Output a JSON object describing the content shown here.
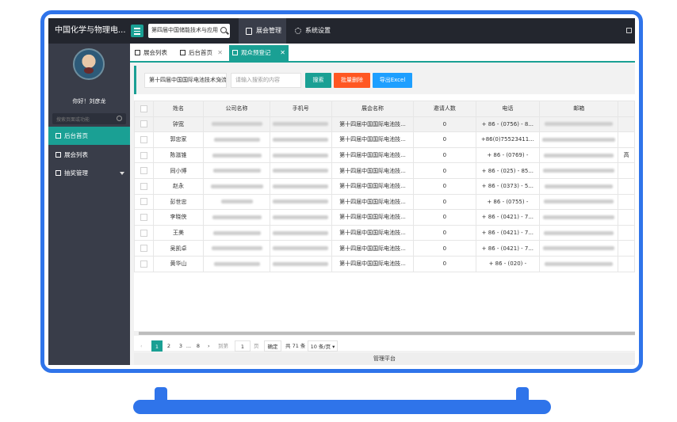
{
  "app": {
    "title": "中国化学与物理电...",
    "search_value": "第四届中国储能技术与应用展览会",
    "menus": [
      {
        "label": "展会管理",
        "icon": "calendar-icon",
        "active": true
      },
      {
        "label": "系统设置",
        "icon": "gear-icon",
        "active": false
      }
    ]
  },
  "sidebar": {
    "greeting": "你好！刘彦龙",
    "search_placeholder": "搜索页面或功能",
    "items": [
      {
        "label": "后台首页",
        "icon": "home-icon",
        "active": true
      },
      {
        "label": "展会列表",
        "icon": "list-icon",
        "active": false
      },
      {
        "label": "抽奖管理",
        "icon": "print-icon",
        "active": false
      }
    ]
  },
  "tabs": [
    {
      "label": "展会列表",
      "closable": false,
      "active": false
    },
    {
      "label": "后台首页",
      "closable": true,
      "active": false
    },
    {
      "label": "观众预登记",
      "closable": true,
      "active": true
    }
  ],
  "filter": {
    "expo_select": "第十四届中国国际电池技术交流会",
    "keyword_placeholder": "请输入搜索的内容",
    "search_label": "搜索",
    "batch_delete_label": "批量删除",
    "export_label": "导出Excel",
    "colors": {
      "search": "#1aa094",
      "delete": "#ff5722",
      "export": "#1e9fff"
    }
  },
  "table": {
    "headers": [
      "姓名",
      "公司名称",
      "手机号",
      "展会名称",
      "邀请人数",
      "电话",
      "邮箱"
    ],
    "rows": [
      {
        "name": "钟宽",
        "expo": "第十四届中国国际电池技...",
        "invites": "0",
        "phone": "+ 86 - (0756) - 8...",
        "extra": ""
      },
      {
        "name": "郭忠家",
        "expo": "第十四届中国国际电池技...",
        "invites": "0",
        "phone": "+86(0)75523411...",
        "extra": ""
      },
      {
        "name": "陈滋锥",
        "expo": "第十四届中国国际电池技...",
        "invites": "0",
        "phone": "+ 86 - (0769) -",
        "extra": "高"
      },
      {
        "name": "同小博",
        "expo": "第十四届中国国际电池技...",
        "invites": "0",
        "phone": "+ 86 - (025) - 85...",
        "extra": ""
      },
      {
        "name": "赵永",
        "expo": "第十四届中国国际电池技...",
        "invites": "0",
        "phone": "+ 86 - (0373) - 5...",
        "extra": ""
      },
      {
        "name": "彭世忠",
        "expo": "第十四届中国国际电池技...",
        "invites": "0",
        "phone": "+ 86 - (0755) -",
        "extra": ""
      },
      {
        "name": "李晓侠",
        "expo": "第十四届中国国际电池技...",
        "invites": "0",
        "phone": "+ 86 - (0421) - 7...",
        "extra": ""
      },
      {
        "name": "王美",
        "expo": "第十四届中国国际电池技...",
        "invites": "0",
        "phone": "+ 86 - (0421) - 7...",
        "extra": ""
      },
      {
        "name": "吴凯卓",
        "expo": "第十四届中国国际电池技...",
        "invites": "0",
        "phone": "+ 86 - (0421) - 7...",
        "extra": ""
      },
      {
        "name": "黄华山",
        "expo": "第十四届中国国际电池技...",
        "invites": "0",
        "phone": "+ 86 - (020) -",
        "extra": ""
      }
    ]
  },
  "pager": {
    "prev": "‹",
    "pages": [
      "1",
      "2",
      "3",
      "...",
      "8"
    ],
    "next": "›",
    "goto_label": "到第",
    "goto_value": "1",
    "page_unit": "页",
    "confirm_label": "确定",
    "total": "共 71 条",
    "per_page": "10 条/页"
  },
  "footer": {
    "text": "管理平台"
  },
  "accent": "#1aa094",
  "frame_color": "#2f74ea"
}
